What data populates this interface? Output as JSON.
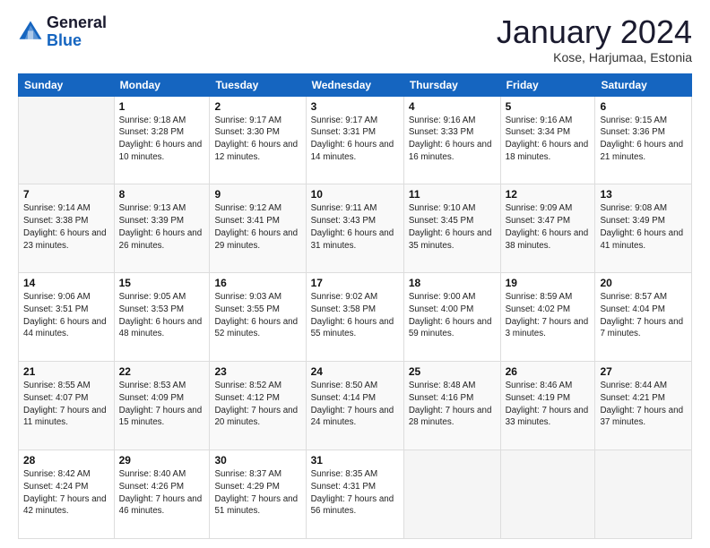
{
  "logo": {
    "line1": "General",
    "line2": "Blue"
  },
  "title": "January 2024",
  "subtitle": "Kose, Harjumaa, Estonia",
  "weekdays": [
    "Sunday",
    "Monday",
    "Tuesday",
    "Wednesday",
    "Thursday",
    "Friday",
    "Saturday"
  ],
  "weeks": [
    [
      {
        "day": "",
        "sunrise": "",
        "sunset": "",
        "daylight": ""
      },
      {
        "day": "1",
        "sunrise": "Sunrise: 9:18 AM",
        "sunset": "Sunset: 3:28 PM",
        "daylight": "Daylight: 6 hours and 10 minutes."
      },
      {
        "day": "2",
        "sunrise": "Sunrise: 9:17 AM",
        "sunset": "Sunset: 3:30 PM",
        "daylight": "Daylight: 6 hours and 12 minutes."
      },
      {
        "day": "3",
        "sunrise": "Sunrise: 9:17 AM",
        "sunset": "Sunset: 3:31 PM",
        "daylight": "Daylight: 6 hours and 14 minutes."
      },
      {
        "day": "4",
        "sunrise": "Sunrise: 9:16 AM",
        "sunset": "Sunset: 3:33 PM",
        "daylight": "Daylight: 6 hours and 16 minutes."
      },
      {
        "day": "5",
        "sunrise": "Sunrise: 9:16 AM",
        "sunset": "Sunset: 3:34 PM",
        "daylight": "Daylight: 6 hours and 18 minutes."
      },
      {
        "day": "6",
        "sunrise": "Sunrise: 9:15 AM",
        "sunset": "Sunset: 3:36 PM",
        "daylight": "Daylight: 6 hours and 21 minutes."
      }
    ],
    [
      {
        "day": "7",
        "sunrise": "Sunrise: 9:14 AM",
        "sunset": "Sunset: 3:38 PM",
        "daylight": "Daylight: 6 hours and 23 minutes."
      },
      {
        "day": "8",
        "sunrise": "Sunrise: 9:13 AM",
        "sunset": "Sunset: 3:39 PM",
        "daylight": "Daylight: 6 hours and 26 minutes."
      },
      {
        "day": "9",
        "sunrise": "Sunrise: 9:12 AM",
        "sunset": "Sunset: 3:41 PM",
        "daylight": "Daylight: 6 hours and 29 minutes."
      },
      {
        "day": "10",
        "sunrise": "Sunrise: 9:11 AM",
        "sunset": "Sunset: 3:43 PM",
        "daylight": "Daylight: 6 hours and 31 minutes."
      },
      {
        "day": "11",
        "sunrise": "Sunrise: 9:10 AM",
        "sunset": "Sunset: 3:45 PM",
        "daylight": "Daylight: 6 hours and 35 minutes."
      },
      {
        "day": "12",
        "sunrise": "Sunrise: 9:09 AM",
        "sunset": "Sunset: 3:47 PM",
        "daylight": "Daylight: 6 hours and 38 minutes."
      },
      {
        "day": "13",
        "sunrise": "Sunrise: 9:08 AM",
        "sunset": "Sunset: 3:49 PM",
        "daylight": "Daylight: 6 hours and 41 minutes."
      }
    ],
    [
      {
        "day": "14",
        "sunrise": "Sunrise: 9:06 AM",
        "sunset": "Sunset: 3:51 PM",
        "daylight": "Daylight: 6 hours and 44 minutes."
      },
      {
        "day": "15",
        "sunrise": "Sunrise: 9:05 AM",
        "sunset": "Sunset: 3:53 PM",
        "daylight": "Daylight: 6 hours and 48 minutes."
      },
      {
        "day": "16",
        "sunrise": "Sunrise: 9:03 AM",
        "sunset": "Sunset: 3:55 PM",
        "daylight": "Daylight: 6 hours and 52 minutes."
      },
      {
        "day": "17",
        "sunrise": "Sunrise: 9:02 AM",
        "sunset": "Sunset: 3:58 PM",
        "daylight": "Daylight: 6 hours and 55 minutes."
      },
      {
        "day": "18",
        "sunrise": "Sunrise: 9:00 AM",
        "sunset": "Sunset: 4:00 PM",
        "daylight": "Daylight: 6 hours and 59 minutes."
      },
      {
        "day": "19",
        "sunrise": "Sunrise: 8:59 AM",
        "sunset": "Sunset: 4:02 PM",
        "daylight": "Daylight: 7 hours and 3 minutes."
      },
      {
        "day": "20",
        "sunrise": "Sunrise: 8:57 AM",
        "sunset": "Sunset: 4:04 PM",
        "daylight": "Daylight: 7 hours and 7 minutes."
      }
    ],
    [
      {
        "day": "21",
        "sunrise": "Sunrise: 8:55 AM",
        "sunset": "Sunset: 4:07 PM",
        "daylight": "Daylight: 7 hours and 11 minutes."
      },
      {
        "day": "22",
        "sunrise": "Sunrise: 8:53 AM",
        "sunset": "Sunset: 4:09 PM",
        "daylight": "Daylight: 7 hours and 15 minutes."
      },
      {
        "day": "23",
        "sunrise": "Sunrise: 8:52 AM",
        "sunset": "Sunset: 4:12 PM",
        "daylight": "Daylight: 7 hours and 20 minutes."
      },
      {
        "day": "24",
        "sunrise": "Sunrise: 8:50 AM",
        "sunset": "Sunset: 4:14 PM",
        "daylight": "Daylight: 7 hours and 24 minutes."
      },
      {
        "day": "25",
        "sunrise": "Sunrise: 8:48 AM",
        "sunset": "Sunset: 4:16 PM",
        "daylight": "Daylight: 7 hours and 28 minutes."
      },
      {
        "day": "26",
        "sunrise": "Sunrise: 8:46 AM",
        "sunset": "Sunset: 4:19 PM",
        "daylight": "Daylight: 7 hours and 33 minutes."
      },
      {
        "day": "27",
        "sunrise": "Sunrise: 8:44 AM",
        "sunset": "Sunset: 4:21 PM",
        "daylight": "Daylight: 7 hours and 37 minutes."
      }
    ],
    [
      {
        "day": "28",
        "sunrise": "Sunrise: 8:42 AM",
        "sunset": "Sunset: 4:24 PM",
        "daylight": "Daylight: 7 hours and 42 minutes."
      },
      {
        "day": "29",
        "sunrise": "Sunrise: 8:40 AM",
        "sunset": "Sunset: 4:26 PM",
        "daylight": "Daylight: 7 hours and 46 minutes."
      },
      {
        "day": "30",
        "sunrise": "Sunrise: 8:37 AM",
        "sunset": "Sunset: 4:29 PM",
        "daylight": "Daylight: 7 hours and 51 minutes."
      },
      {
        "day": "31",
        "sunrise": "Sunrise: 8:35 AM",
        "sunset": "Sunset: 4:31 PM",
        "daylight": "Daylight: 7 hours and 56 minutes."
      },
      {
        "day": "",
        "sunrise": "",
        "sunset": "",
        "daylight": ""
      },
      {
        "day": "",
        "sunrise": "",
        "sunset": "",
        "daylight": ""
      },
      {
        "day": "",
        "sunrise": "",
        "sunset": "",
        "daylight": ""
      }
    ]
  ]
}
